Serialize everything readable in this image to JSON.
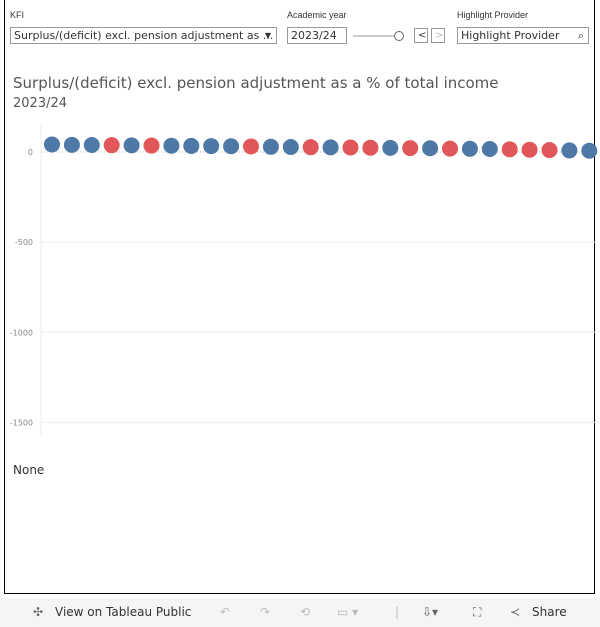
{
  "filters": {
    "kfi_label": "KFI",
    "kfi_value": "Surplus/(deficit) excl. pension adjustment as ...",
    "year_label": "Academic year",
    "year_value": "2023/24",
    "provider_label": "Highlight Provider",
    "provider_placeholder": "Highlight Provider"
  },
  "title": "Surplus/(deficit) excl. pension adjustment as a % of total income",
  "subtitle": "2023/24",
  "none_label": "None",
  "colors": {
    "default": "#4e79a7",
    "highlight": "#e15759"
  },
  "chart_data": {
    "type": "scatter",
    "ylim": [
      -1570,
      150
    ],
    "yticks": [
      0,
      -500,
      -1000,
      -1500
    ],
    "tick_labels": [
      "0",
      "-500",
      "-1000",
      "-1500"
    ],
    "grid": true,
    "values": [
      42,
      40,
      39,
      38,
      37,
      36,
      35,
      34,
      33,
      32,
      31,
      29,
      28,
      27,
      26,
      25,
      24,
      23,
      22,
      21,
      19,
      18,
      17,
      15,
      13,
      11,
      9,
      7
    ],
    "highlight": [
      0,
      0,
      0,
      1,
      0,
      1,
      0,
      0,
      0,
      0,
      1,
      0,
      0,
      1,
      0,
      1,
      1,
      0,
      1,
      0,
      1,
      0,
      0,
      1,
      1,
      1,
      0,
      0
    ]
  },
  "toolbar": {
    "view": "View on Tableau Public",
    "share": "Share"
  }
}
